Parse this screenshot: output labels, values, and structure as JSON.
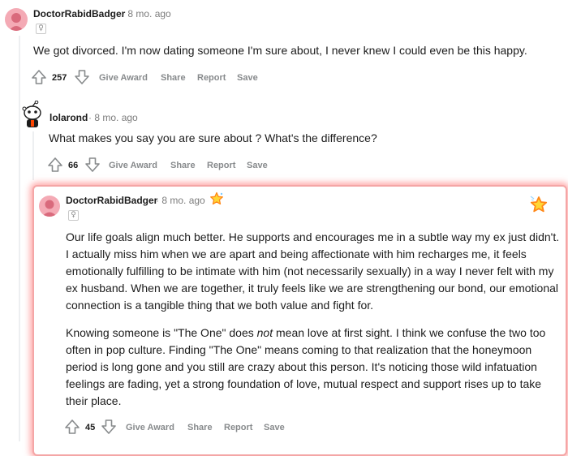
{
  "comments": [
    {
      "username": "DoctorRabidBadger",
      "time": "8 mo. ago",
      "flair_icon": "female-symbol-icon",
      "body": "We got divorced. I'm now dating someone I'm sure about, I never knew I could even be this happy.",
      "votes": "257",
      "actions": {
        "award": "Give Award",
        "share": "Share",
        "report": "Report",
        "save": "Save"
      }
    },
    {
      "username": "lolarond",
      "time": "8 mo. ago",
      "body": "What makes you say you are sure about ? What's the difference?",
      "votes": "66",
      "actions": {
        "award": "Give Award",
        "share": "Share",
        "report": "Report",
        "save": "Save"
      }
    },
    {
      "username": "DoctorRabidBadger",
      "time": "8 mo. ago",
      "flair_icon": "female-symbol-icon",
      "paragraph1": "Our life goals align much better. He supports and encourages me in a subtle way my ex just didn't. I actually miss him when we are apart and being affectionate with him recharges me, it feels emotionally fulfilling to be intimate with him (not necessarily sexually) in a way I never felt with my ex husband. When we are together, it truly feels like we are strengthening our bond, our emotional connection is a tangible thing that we both value and fight for.",
      "paragraph2_before": "Knowing someone is \"The One\" does ",
      "paragraph2_em": "not",
      "paragraph2_after": " mean love at first sight. I think we confuse the two too often in pop culture. Finding \"The One\" means coming to that realization that the honeymoon period is long gone and you still are crazy about this person. It's noticing those wild infatuation feelings are fading, yet a strong foundation of love, mutual respect and support rises up to take their place.",
      "votes": "45",
      "actions": {
        "award": "Give Award",
        "share": "Share",
        "report": "Report",
        "save": "Save"
      }
    }
  ],
  "colors": {
    "highlight_border": "#f4a6a6",
    "award_orange": "#ff8717",
    "avatar_pink": "#f4aab5"
  }
}
